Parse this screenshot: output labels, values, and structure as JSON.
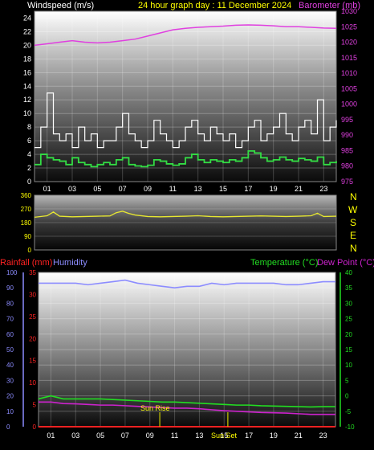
{
  "header": {
    "left_label": "Windspeed (m/s)",
    "center_label": "24 hour graph day : 11 December 2024",
    "right_label": "Barometer (mb)"
  },
  "colors": {
    "wind_gust": "#ffffff",
    "wind_avg": "#33dd44",
    "barometer": "#e040e0",
    "wind_dir": "#e8e830",
    "humidity": "#8c8cff",
    "temperature": "#22dd22",
    "dew_point": "#cc22cc",
    "rainfall": "#ff2222",
    "sun_marker": "#c8c800",
    "header_title": "#ffff00"
  },
  "direction_labels": [
    "N",
    "W",
    "S",
    "E",
    "N"
  ],
  "bottom_labels": {
    "rainfall": "Rainfall (mm)",
    "humidity": "Humidity",
    "temperature": "Temperature (°C)",
    "dew_point": "Dew Point (°C)"
  },
  "annotations": {
    "sun_rise": "Sun Rise",
    "sun_set": "Sun Set"
  },
  "chart_data": [
    {
      "type": "line",
      "x_ticks": [
        "01",
        "03",
        "05",
        "07",
        "09",
        "11",
        "13",
        "15",
        "17",
        "19",
        "21",
        "23"
      ],
      "left_axis": {
        "ylim": [
          0,
          25
        ],
        "ticks": [
          0,
          2,
          4,
          6,
          8,
          10,
          12,
          14,
          16,
          18,
          20,
          22,
          24
        ]
      },
      "right_axis": {
        "ylim": [
          975,
          1030
        ],
        "ticks": [
          975,
          980,
          985,
          990,
          995,
          1000,
          1005,
          1010,
          1015,
          1020,
          1025,
          1030
        ]
      },
      "x_range_hours": [
        0,
        24
      ],
      "series": [
        {
          "name": "Windspeed (m/s)",
          "role": "gust",
          "axis": "left",
          "x": [
            0,
            0.5,
            1,
            1.5,
            2,
            2.5,
            3,
            3.5,
            4,
            4.5,
            5,
            5.5,
            6,
            6.5,
            7,
            7.5,
            8,
            8.5,
            9,
            9.5,
            10,
            10.5,
            11,
            11.5,
            12,
            12.5,
            13,
            13.5,
            14,
            14.5,
            15,
            15.5,
            16,
            16.5,
            17,
            17.5,
            18,
            18.5,
            19,
            19.5,
            20,
            20.5,
            21,
            21.5,
            22,
            22.5,
            23,
            23.5,
            24
          ],
          "values": [
            5,
            8,
            13,
            7,
            6,
            7,
            5,
            8,
            6,
            7,
            5,
            6,
            6,
            8,
            10,
            7,
            6,
            5,
            6,
            9,
            7,
            6,
            5,
            6,
            8,
            9,
            7,
            6,
            8,
            7,
            6,
            7,
            5,
            6,
            8,
            9,
            6,
            7,
            8,
            10,
            7,
            6,
            8,
            9,
            7,
            12,
            6,
            8,
            9
          ]
        },
        {
          "name": "Windspeed (m/s)",
          "role": "average",
          "axis": "left",
          "x": [
            0,
            0.5,
            1,
            1.5,
            2,
            2.5,
            3,
            3.5,
            4,
            4.5,
            5,
            5.5,
            6,
            6.5,
            7,
            7.5,
            8,
            8.5,
            9,
            9.5,
            10,
            10.5,
            11,
            11.5,
            12,
            12.5,
            13,
            13.5,
            14,
            14.5,
            15,
            15.5,
            16,
            16.5,
            17,
            17.5,
            18,
            18.5,
            19,
            19.5,
            20,
            20.5,
            21,
            21.5,
            22,
            22.5,
            23,
            23.5,
            24
          ],
          "values": [
            2.5,
            4,
            3.5,
            3.2,
            3,
            2.5,
            3.5,
            2.8,
            2.5,
            2.2,
            2.5,
            2.8,
            2.5,
            3.2,
            3.5,
            2.5,
            2.3,
            2.2,
            2.4,
            3.2,
            3,
            2.6,
            2.4,
            2.6,
            3.5,
            4,
            3.2,
            2.8,
            3.2,
            3,
            2.8,
            3.2,
            3,
            3.5,
            4.5,
            4.2,
            3.5,
            3,
            3.2,
            3.6,
            3.2,
            3,
            3.4,
            3.2,
            3,
            3.6,
            2.5,
            2.8,
            3
          ]
        },
        {
          "name": "Barometer (mb)",
          "axis": "right",
          "x": [
            0,
            1,
            2,
            3,
            4,
            5,
            6,
            7,
            8,
            9,
            10,
            11,
            12,
            13,
            14,
            15,
            16,
            17,
            18,
            19,
            20,
            21,
            22,
            23,
            24
          ],
          "values": [
            1019,
            1019.5,
            1020,
            1020.5,
            1020,
            1019.8,
            1020,
            1020.5,
            1021,
            1022,
            1023,
            1024,
            1024.5,
            1024.8,
            1025,
            1025.2,
            1025.5,
            1025.6,
            1025.5,
            1025.3,
            1025,
            1025,
            1024.8,
            1024.6,
            1024.5
          ]
        }
      ]
    },
    {
      "type": "line",
      "x_range_hours": [
        0,
        24
      ],
      "left_axis": {
        "ylim": [
          0,
          360
        ],
        "ticks": [
          0,
          90,
          180,
          270,
          360
        ]
      },
      "series": [
        {
          "name": "Wind direction",
          "axis": "left",
          "x": [
            0,
            1,
            1.5,
            2,
            3,
            4,
            5,
            6,
            6.5,
            7,
            7.5,
            8,
            9,
            10,
            11,
            12,
            13,
            14,
            15,
            16,
            17,
            18,
            19,
            20,
            21,
            22,
            22.5,
            23,
            24
          ],
          "values": [
            215,
            225,
            250,
            222,
            218,
            220,
            222,
            224,
            245,
            255,
            240,
            230,
            220,
            218,
            220,
            222,
            225,
            220,
            218,
            220,
            222,
            224,
            222,
            220,
            222,
            225,
            242,
            220,
            222
          ]
        }
      ]
    },
    {
      "type": "line",
      "x_range_hours": [
        0,
        24
      ],
      "left_axis": {
        "ylim": [
          0,
          100
        ],
        "ticks": [
          0,
          10,
          20,
          30,
          40,
          50,
          60,
          70,
          80,
          90,
          100
        ],
        "label": "Humidity"
      },
      "rain_axis": {
        "ylim": [
          0,
          35
        ],
        "ticks": [
          0,
          5,
          10,
          15,
          20,
          25,
          30,
          35
        ],
        "label": "Rainfall (mm)"
      },
      "right_axis": {
        "ylim": [
          -10,
          40
        ],
        "ticks": [
          -10,
          -5,
          0,
          5,
          10,
          15,
          20,
          25,
          30,
          35,
          40
        ],
        "label": "Temperature (°C)"
      },
      "sun_rise_hour": 9.8,
      "sun_set_hour": 15.3,
      "series": [
        {
          "name": "Humidity",
          "axis": "left",
          "x": [
            0,
            1,
            2,
            3,
            4,
            5,
            6,
            7,
            8,
            9,
            10,
            11,
            12,
            13,
            14,
            15,
            16,
            17,
            18,
            19,
            20,
            21,
            22,
            23,
            24
          ],
          "values": [
            93,
            93,
            93,
            93,
            92,
            93,
            94,
            95,
            93,
            92,
            91,
            90,
            91,
            91,
            93,
            92,
            93,
            93,
            93,
            93,
            92,
            92,
            93,
            94,
            94
          ]
        },
        {
          "name": "Temperature (°C)",
          "axis": "right",
          "x": [
            0,
            1,
            2,
            3,
            4,
            5,
            6,
            7,
            8,
            9,
            10,
            11,
            12,
            13,
            14,
            15,
            16,
            17,
            18,
            19,
            20,
            21,
            22,
            23,
            24
          ],
          "values": [
            -1,
            0,
            -1,
            -1,
            -1,
            -1,
            -1.2,
            -1.4,
            -1.6,
            -1.8,
            -2,
            -2,
            -2.2,
            -2.4,
            -2.6,
            -2.8,
            -3,
            -3,
            -3.2,
            -3.3,
            -3.4,
            -3.5,
            -3.6,
            -3.5,
            -3.5
          ]
        },
        {
          "name": "Dew Point (°C)",
          "axis": "right",
          "x": [
            0,
            1,
            2,
            3,
            4,
            5,
            6,
            7,
            8,
            9,
            10,
            11,
            12,
            13,
            14,
            15,
            16,
            17,
            18,
            19,
            20,
            21,
            22,
            23,
            24
          ],
          "values": [
            -2,
            -2,
            -2.5,
            -2.6,
            -2.8,
            -3,
            -3,
            -3.2,
            -3.4,
            -3.6,
            -3.8,
            -4,
            -4,
            -4.2,
            -4.5,
            -4.8,
            -5,
            -5.2,
            -5.4,
            -5.5,
            -5.6,
            -5.8,
            -6,
            -6,
            -6
          ]
        },
        {
          "name": "Rainfall (mm)",
          "axis": "rain",
          "x": [
            0,
            24
          ],
          "values": [
            0,
            0
          ]
        }
      ]
    }
  ]
}
